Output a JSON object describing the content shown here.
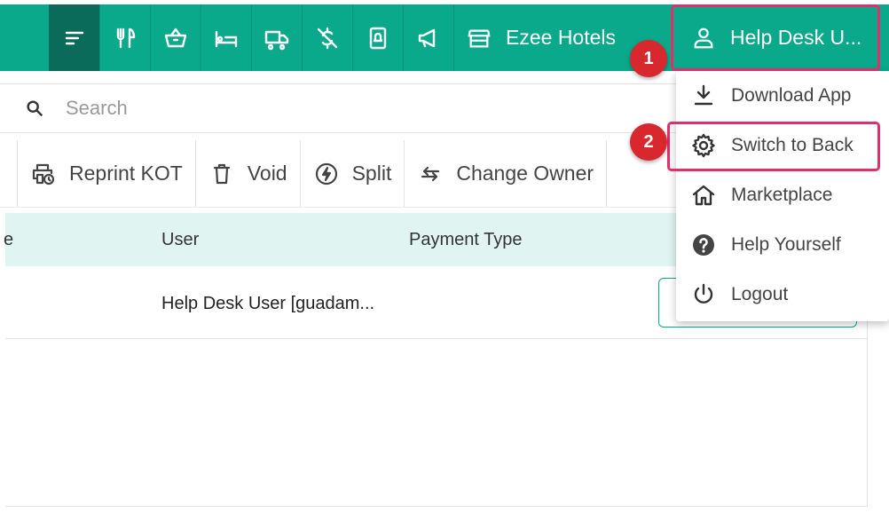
{
  "topbar": {
    "hotel_name": "Ezee Hotels",
    "user_name": "Help Desk U...",
    "icons": [
      "menu-icon",
      "restaurant-icon",
      "basket-icon",
      "bed-icon",
      "truck-icon",
      "dollar-off-icon",
      "phone-notification-icon",
      "megaphone-icon",
      "store-icon",
      "user-icon"
    ]
  },
  "search": {
    "placeholder": "Search"
  },
  "toolbar": {
    "reprint_label": "Reprint KOT",
    "void_label": "Void",
    "split_label": "Split",
    "change_owner_label": "Change Owner"
  },
  "table": {
    "columns": {
      "user": "User",
      "payment_type": "Payment Type"
    },
    "rows": [
      {
        "user": "Help Desk User [guadam..."
      }
    ]
  },
  "menu": {
    "items": [
      {
        "label": "Download App",
        "icon": "download-icon"
      },
      {
        "label": "Switch to Back",
        "icon": "gear-icon"
      },
      {
        "label": "Marketplace",
        "icon": "home-icon"
      },
      {
        "label": "Help Yourself",
        "icon": "help-circle-icon"
      },
      {
        "label": "Logout",
        "icon": "power-icon"
      }
    ]
  },
  "annotations": {
    "step1": "1",
    "step2": "2"
  },
  "colors": {
    "primary": "#0aa98c",
    "active": "#0b6b5b",
    "highlight": "#e0306a",
    "badge": "#d9272e"
  }
}
